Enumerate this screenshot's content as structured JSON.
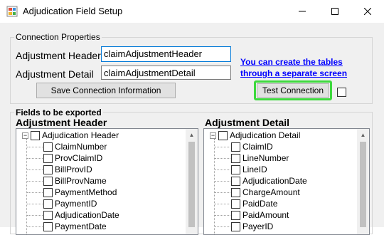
{
  "window": {
    "title": "Adjudication Field Setup"
  },
  "connection": {
    "group_title": "Connection Properties",
    "header_label": "Adjustment Header",
    "header_value": "claimAdjustmentHeader",
    "detail_label": "Adjustment Detail",
    "detail_value": "claimAdjustmentDetail",
    "save_label": "Save Connection Information",
    "link_line1": "You can create the tables",
    "link_line2": "through a separate screen",
    "test_label": "Test Connection"
  },
  "fields": {
    "group_title": "Fields to be exported",
    "header_title": "Adjustment Header",
    "detail_title": "Adjustment Detail",
    "header_tree": {
      "root": "Adjudication Header",
      "items": [
        "ClaimNumber",
        "ProvClaimID",
        "BillProvID",
        "BillProvName",
        "PaymentMethod",
        "PaymentID",
        "AdjudicationDate",
        "PaymentDate"
      ]
    },
    "detail_tree": {
      "root": "Adjudication Detail",
      "items": [
        "ClaimID",
        "LineNumber",
        "LineID",
        "AdjudicationDate",
        "ChargeAmount",
        "PaidDate",
        "PaidAmount",
        "PayerID"
      ]
    }
  },
  "colors": {
    "highlight": "#3ed93e",
    "link": "#0000ff",
    "focus": "#0078d7"
  },
  "icons": {
    "app": "app-icon",
    "minimize": "minimize-icon",
    "maximize": "maximize-icon",
    "close": "close-icon"
  }
}
